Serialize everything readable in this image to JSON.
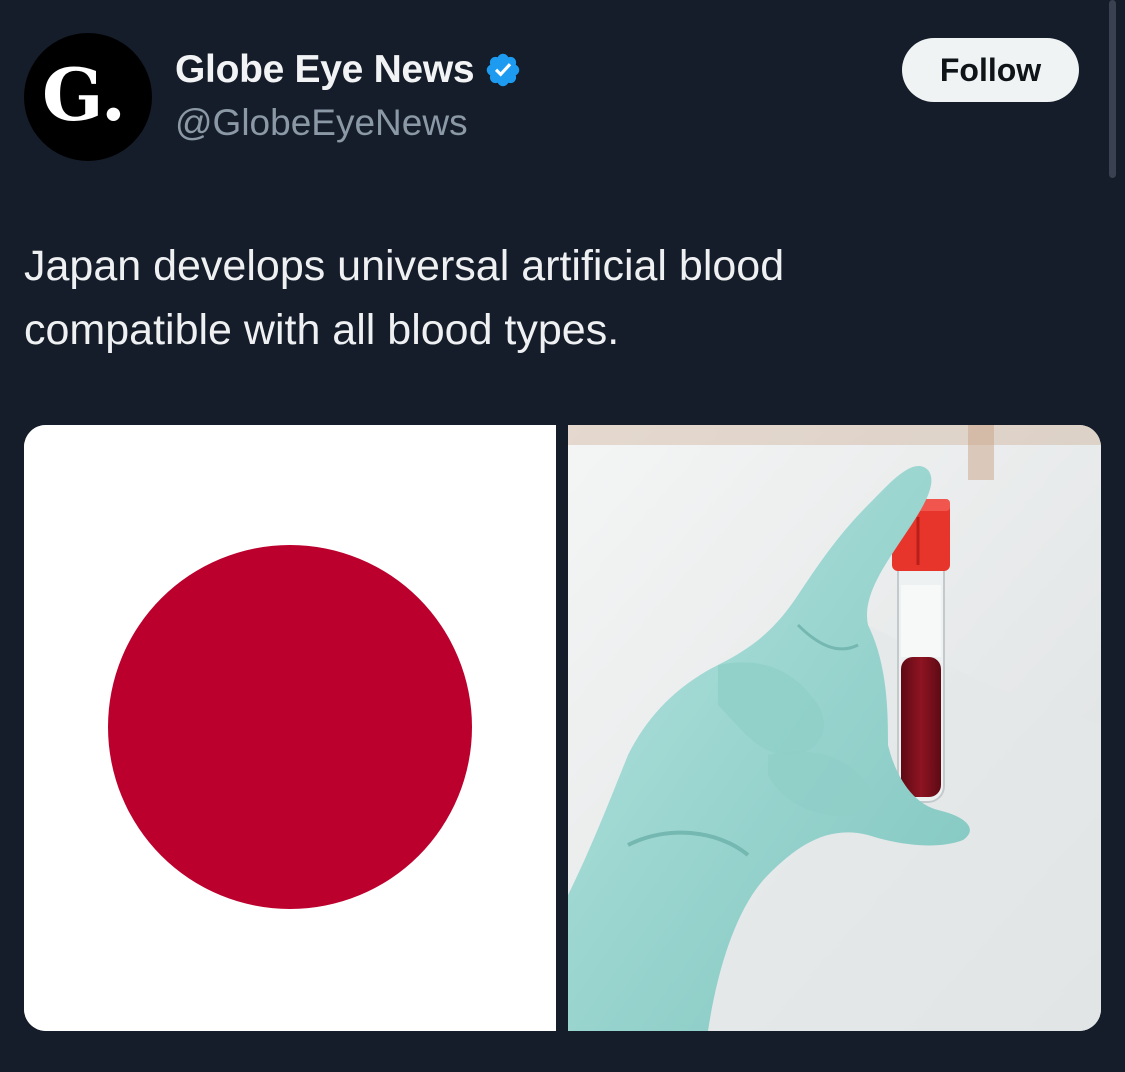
{
  "account": {
    "display_name": "Globe Eye News",
    "handle": "@GlobeEyeNews",
    "avatar_letter": "G.",
    "verified": true,
    "verified_color": "#1d9bf0"
  },
  "actions": {
    "follow_label": "Follow"
  },
  "tweet": {
    "text_line1": "Japan develops universal artificial blood",
    "text_line2": "compatible with all blood types."
  },
  "media": {
    "images": [
      {
        "icon": "japan-flag",
        "flag_red": "#bc002d"
      },
      {
        "icon": "blood-vial-in-gloved-hand",
        "glove_color": "#9ed8d2",
        "cap_color": "#e8352b",
        "blood_color": "#7a0f1a"
      }
    ]
  },
  "colors": {
    "background": "#151d2a",
    "text_primary": "#eef0f2",
    "text_secondary": "#8b98a5"
  }
}
